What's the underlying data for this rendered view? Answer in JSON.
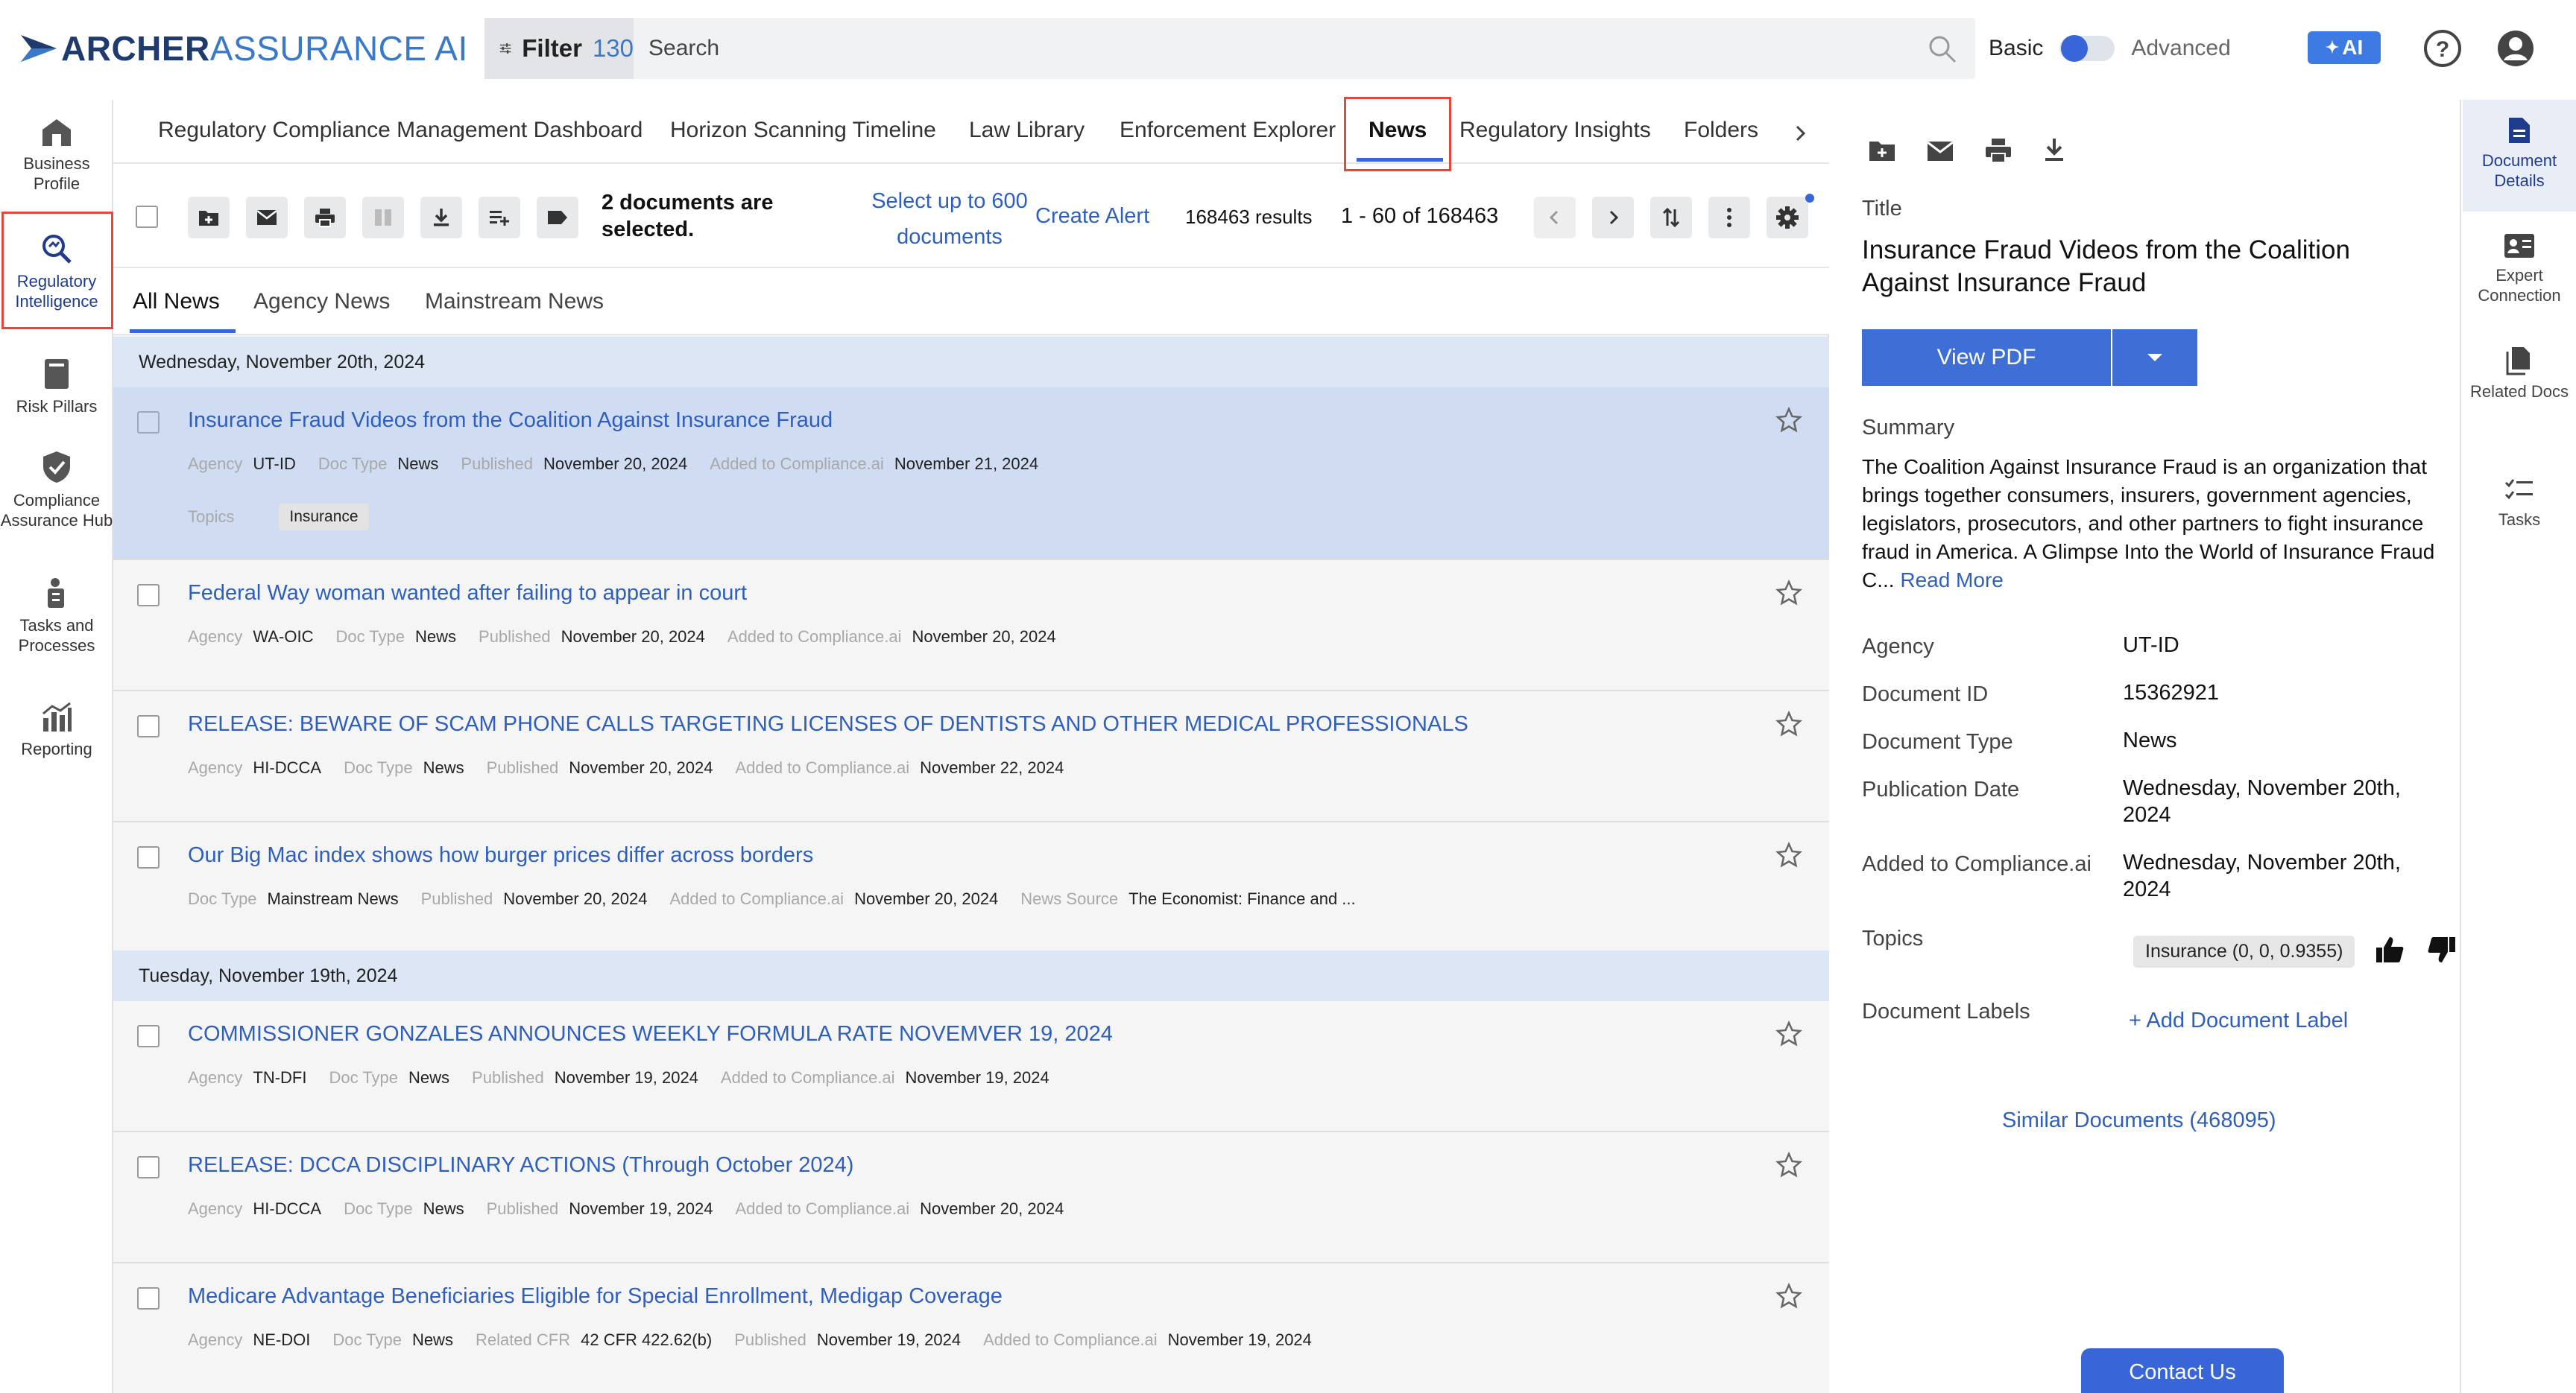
{
  "app": {
    "brand_bold": "ARCHER",
    "brand_light": "ASSURANCE AI"
  },
  "search": {
    "filter_label": "Filter",
    "filter_count": "130",
    "placeholder": "Search"
  },
  "mode": {
    "basic": "Basic",
    "advanced": "Advanced",
    "basic_selected": true
  },
  "ai_button": "AI",
  "left_nav": [
    {
      "label": "Business Profile",
      "icon": "building-icon"
    },
    {
      "label": "Regulatory Intelligence",
      "icon": "magnify-icon",
      "active": true
    },
    {
      "label": "Risk Pillars",
      "icon": "book-icon"
    },
    {
      "label": "Compliance Assurance Hub",
      "icon": "shield-check-icon"
    },
    {
      "label": "Tasks and Processes",
      "icon": "person-tasks-icon"
    },
    {
      "label": "Reporting",
      "icon": "chart-icon"
    }
  ],
  "tabs": [
    {
      "label": "Regulatory Compliance Management Dashboard"
    },
    {
      "label": "Horizon Scanning Timeline"
    },
    {
      "label": "Law Library"
    },
    {
      "label": "Enforcement Explorer"
    },
    {
      "label": "News",
      "active": true
    },
    {
      "label": "Regulatory Insights"
    },
    {
      "label": "Folders"
    }
  ],
  "toolbar": {
    "selected_text_1": "2 documents are",
    "selected_text_2": "selected.",
    "select_up_1": "Select up to 600",
    "select_up_2": "documents",
    "create_alert": "Create Alert",
    "results": "168463 results",
    "range": "1 - 60 of 168463"
  },
  "subtabs": [
    {
      "label": "All News",
      "active": true
    },
    {
      "label": "Agency News"
    },
    {
      "label": "Mainstream News"
    }
  ],
  "days": [
    {
      "header": "Wednesday, November 20th, 2024",
      "items": [
        {
          "title": "Insurance Fraud Videos from the Coalition Against Insurance Fraud",
          "selected": true,
          "meta": [
            [
              "Agency",
              "UT-ID"
            ],
            [
              "Doc Type",
              "News"
            ],
            [
              "Published",
              "November 20, 2024"
            ],
            [
              "Added to Compliance.ai",
              "November 21, 2024"
            ]
          ],
          "topics_label": "Topics",
          "topics": [
            "Insurance"
          ]
        },
        {
          "title": "Federal Way woman wanted after failing to appear in court",
          "meta": [
            [
              "Agency",
              "WA-OIC"
            ],
            [
              "Doc Type",
              "News"
            ],
            [
              "Published",
              "November 20, 2024"
            ],
            [
              "Added to Compliance.ai",
              "November 20, 2024"
            ]
          ]
        },
        {
          "title": "RELEASE: BEWARE OF SCAM PHONE CALLS TARGETING LICENSES OF DENTISTS AND OTHER MEDICAL PROFESSIONALS",
          "meta": [
            [
              "Agency",
              "HI-DCCA"
            ],
            [
              "Doc Type",
              "News"
            ],
            [
              "Published",
              "November 20, 2024"
            ],
            [
              "Added to Compliance.ai",
              "November 22, 2024"
            ]
          ]
        },
        {
          "title": "Our Big Mac index shows how burger prices differ across borders",
          "meta": [
            [
              "Doc Type",
              "Mainstream News"
            ],
            [
              "Published",
              "November 20, 2024"
            ],
            [
              "Added to Compliance.ai",
              "November 20, 2024"
            ],
            [
              "News Source",
              "The Economist: Finance and ..."
            ]
          ]
        }
      ]
    },
    {
      "header": "Tuesday, November 19th, 2024",
      "items": [
        {
          "title": "COMMISSIONER GONZALES ANNOUNCES WEEKLY FORMULA RATE NOVEMVER 19, 2024",
          "meta": [
            [
              "Agency",
              "TN-DFI"
            ],
            [
              "Doc Type",
              "News"
            ],
            [
              "Published",
              "November 19, 2024"
            ],
            [
              "Added to Compliance.ai",
              "November 19, 2024"
            ]
          ]
        },
        {
          "title": "RELEASE: DCCA DISCIPLINARY ACTIONS (Through October 2024)",
          "meta": [
            [
              "Agency",
              "HI-DCCA"
            ],
            [
              "Doc Type",
              "News"
            ],
            [
              "Published",
              "November 19, 2024"
            ],
            [
              "Added to Compliance.ai",
              "November 20, 2024"
            ]
          ]
        },
        {
          "title": "Medicare Advantage Beneficiaries Eligible for Special Enrollment, Medigap Coverage",
          "meta": [
            [
              "Agency",
              "NE-DOI"
            ],
            [
              "Doc Type",
              "News"
            ],
            [
              "Related CFR",
              "42 CFR 422.62(b)"
            ],
            [
              "Published",
              "November 19, 2024"
            ],
            [
              "Added to Compliance.ai",
              "November 19, 2024"
            ]
          ]
        }
      ]
    }
  ],
  "details": {
    "title_label": "Title",
    "title": "Insurance Fraud Videos from the Coalition Against Insurance Fraud",
    "view_pdf": "View PDF",
    "summary_label": "Summary",
    "summary": "The Coalition Against Insurance Fraud is an organization that brings together consumers, insurers, government agencies, legislators, prosecutors, and other partners to fight insurance fraud in America. A Glimpse Into the World of Insurance Fraud C...",
    "read_more": "Read More",
    "fields": [
      {
        "label": "Agency",
        "value": "UT-ID"
      },
      {
        "label": "Document ID",
        "value": "15362921"
      },
      {
        "label": "Document Type",
        "value": "News"
      },
      {
        "label": "Publication Date",
        "value": "Wednesday, November 20th, 2024"
      },
      {
        "label": "Added to Compliance.ai",
        "value": "Wednesday, November 20th, 2024"
      }
    ],
    "topics_label": "Topics",
    "topic_chip": "Insurance (0, 0, 0.9355)",
    "labels_label": "Document Labels",
    "add_label": "+ Add Document Label",
    "similar": "Similar Documents (468095)",
    "contact": "Contact Us"
  },
  "rail": [
    {
      "label": "Document Details",
      "icon": "document-icon",
      "active": true
    },
    {
      "label": "Expert Connection",
      "icon": "expert-card-icon"
    },
    {
      "label": "Related Docs",
      "icon": "docs-icon"
    },
    {
      "label": "Tasks",
      "icon": "checklist-icon"
    }
  ],
  "colors": {
    "accent": "#3866d8",
    "link": "#2f5fbd",
    "selected_row": "#cfdcf1",
    "day_header": "#dce6f4",
    "highlight_box": "#e4473b"
  }
}
